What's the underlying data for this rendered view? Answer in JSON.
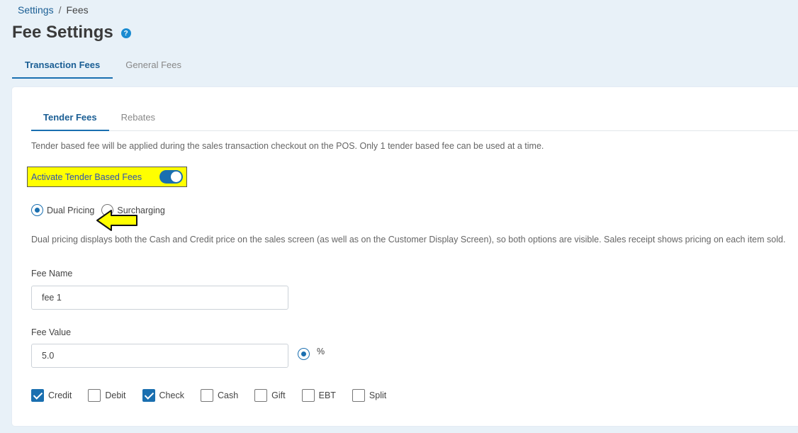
{
  "breadcrumb": {
    "parent": "Settings",
    "separator": "/",
    "current": "Fees"
  },
  "page": {
    "title": "Fee Settings",
    "help_glyph": "?"
  },
  "top_tabs": [
    {
      "label": "Transaction Fees",
      "active": true
    },
    {
      "label": "General Fees",
      "active": false
    }
  ],
  "inner_tabs": [
    {
      "label": "Tender Fees",
      "active": true
    },
    {
      "label": "Rebates",
      "active": false
    }
  ],
  "tender_description": "Tender based fee will be applied during the sales transaction checkout on the POS. Only 1 tender based fee can be used at a time.",
  "activate_toggle": {
    "label": "Activate Tender Based Fees",
    "on": true
  },
  "pricing_options": [
    {
      "label": "Dual Pricing",
      "selected": true
    },
    {
      "label": "Surcharging",
      "selected": false
    }
  ],
  "dual_pricing_description": "Dual pricing displays both the Cash and Credit price on the sales screen (as well as on the Customer Display Screen), so both options are visible. Sales receipt shows pricing on each item sold.",
  "fee_name": {
    "label": "Fee Name",
    "value": "fee 1"
  },
  "fee_value": {
    "label": "Fee Value",
    "value": "5.0",
    "unit_label": "%"
  },
  "tenders": [
    {
      "label": "Credit",
      "checked": true
    },
    {
      "label": "Debit",
      "checked": false
    },
    {
      "label": "Check",
      "checked": true
    },
    {
      "label": "Cash",
      "checked": false
    },
    {
      "label": "Gift",
      "checked": false
    },
    {
      "label": "EBT",
      "checked": false
    },
    {
      "label": "Split",
      "checked": false
    }
  ],
  "colors": {
    "accent": "#1a6fb0",
    "highlight": "#ffff00",
    "background": "#e8f1f8",
    "arrow": "#ffff00"
  },
  "icons": {
    "help": "question-circle-icon",
    "annotation": "yellow-left-arrow-icon"
  }
}
